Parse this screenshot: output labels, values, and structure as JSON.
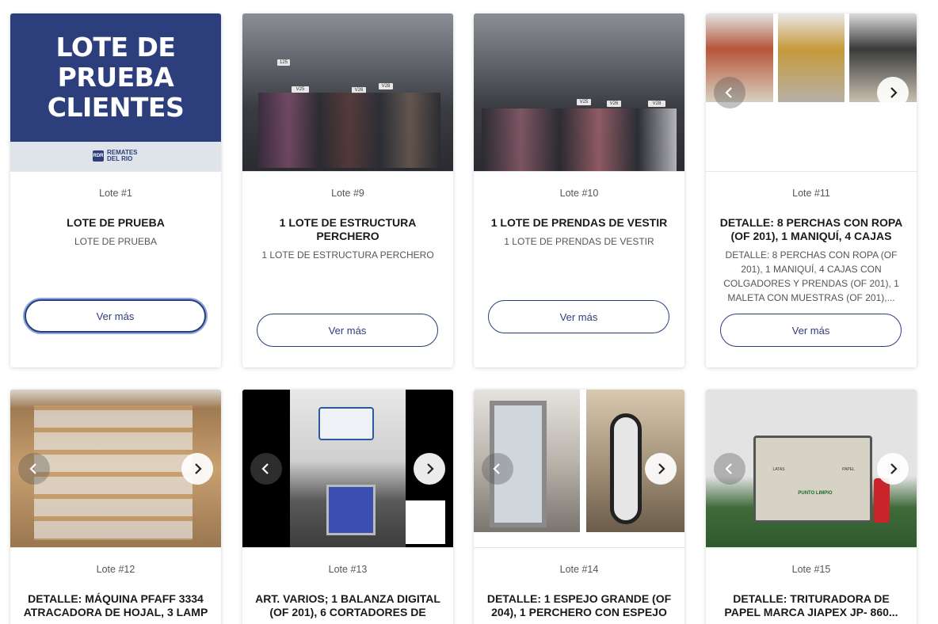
{
  "cards": [
    {
      "lot": "Lote #1",
      "title": "LOTE DE PRUEBA",
      "desc": "LOTE DE PRUEBA",
      "button": "Ver más",
      "promo": {
        "line1": "LOTE DE",
        "line2": "PRUEBA",
        "line3": "CLIENTES",
        "logo_mark": "RDR",
        "logo_line1": "REMATES",
        "logo_line2": "DEL RIO"
      }
    },
    {
      "lot": "Lote #9",
      "title": "1 LOTE DE ESTRUCTURA PERCHERO",
      "desc": "1 LOTE DE ESTRUCTURA PERCHERO",
      "button": "Ver más"
    },
    {
      "lot": "Lote #10",
      "title": "1 LOTE DE PRENDAS DE VESTIR",
      "desc": "1 LOTE DE PRENDAS DE VESTIR",
      "button": "Ver más"
    },
    {
      "lot": "Lote #11",
      "title": "DETALLE: 8 PERCHAS CON ROPA (OF 201), 1 MANIQUÍ, 4 CAJAS",
      "desc": "DETALLE: 8 PERCHAS CON ROPA (OF 201), 1 MANIQUÍ, 4 CAJAS CON COLGADORES Y PRENDAS (OF 201), 1 MALETA CON MUESTRAS (OF 201),...",
      "button": "Ver más"
    },
    {
      "lot": "Lote #12",
      "title": "DETALLE: MÁQUINA PFAFF 3334 ATRACADORA DE HOJAL, 3 LAMP"
    },
    {
      "lot": "Lote #13",
      "title": "ART. VARIOS; 1 BALANZA DIGITAL (OF 201), 6 CORTADORES DE"
    },
    {
      "lot": "Lote #14",
      "title": "DETALLE: 1 ESPEJO GRANDE (OF 204), 1 PERCHERO CON ESPEJO"
    },
    {
      "lot": "Lote #15",
      "title": "DETALLE: TRITURADORA DE PAPEL MARCA JIAPEX JP- 860..."
    }
  ],
  "rack_tags": [
    "125",
    "V25",
    "V26",
    "V28"
  ],
  "bin_labels": {
    "brand": "PUNTO LIMPIO",
    "left": "LATAS",
    "right": "PAPEL"
  },
  "colors": {
    "accent": "#2c3e7a",
    "promo_bg": "#2c3f7c"
  }
}
